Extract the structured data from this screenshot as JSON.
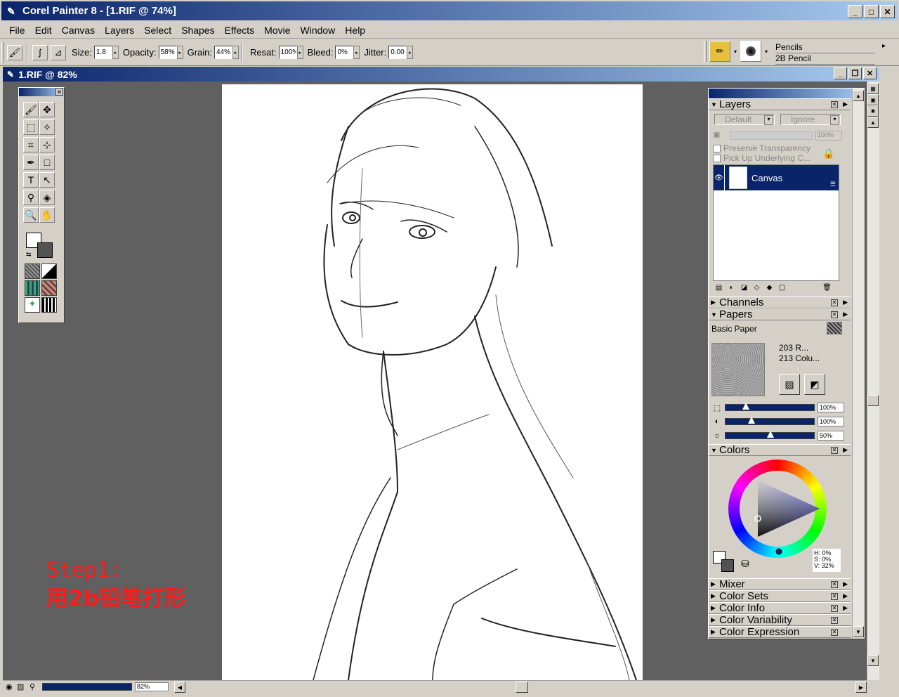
{
  "app": {
    "title": "Corel Painter 8 - [1.RIF @ 74%]",
    "window_buttons": [
      "_",
      "□",
      "✕"
    ]
  },
  "menu": [
    "File",
    "Edit",
    "Canvas",
    "Layers",
    "Select",
    "Shapes",
    "Effects",
    "Movie",
    "Window",
    "Help"
  ],
  "properties": {
    "size_label": "Size:",
    "size_value": "1.8",
    "opacity_label": "Opacity:",
    "opacity_value": "58%",
    "grain_label": "Grain:",
    "grain_value": "44%",
    "resat_label": "Resat:",
    "resat_value": "100%",
    "bleed_label": "Bleed:",
    "bleed_value": "0%",
    "jitter_label": "Jitter:",
    "jitter_value": "0.00"
  },
  "brush": {
    "category": "Pencils",
    "variant": "2B Pencil"
  },
  "document": {
    "title": "1.RIF @ 82%",
    "zoom": "82%"
  },
  "annotation": {
    "line1": "Step1:",
    "line2": "用2b铅笔打形"
  },
  "layers": {
    "title": "Layers",
    "composite_method": "Default",
    "composite_depth": "Ignore",
    "opacity": "100%",
    "preserve_transparency": "Preserve Transparency",
    "pick_up": "Pick Up Underlying C...",
    "items": [
      {
        "name": "Canvas",
        "visible": true,
        "selected": true
      }
    ]
  },
  "channels": {
    "title": "Channels"
  },
  "papers": {
    "title": "Papers",
    "current": "Basic Paper",
    "info_line1": "203 R...",
    "info_line2": "213 Colu...",
    "scale": 0.2,
    "scale_text": "100%",
    "contrast": 0.27,
    "contrast_text": "100%",
    "brightness": 0.5,
    "brightness_text": "50%"
  },
  "colors": {
    "title": "Colors",
    "h": "H: 0%",
    "s": "S: 0%",
    "v": "V: 32%",
    "primary": "#525252",
    "secondary": "#ffffff"
  },
  "collapsed_sections": [
    "Mixer",
    "Color Sets",
    "Color Info",
    "Color Variability",
    "Color Expression"
  ],
  "accent": "#0a246a"
}
